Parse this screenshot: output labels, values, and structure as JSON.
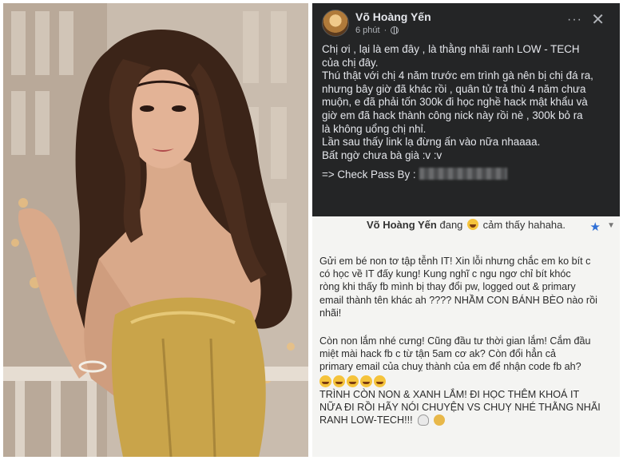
{
  "left_photo": {
    "icon": "woman-portrait-photo"
  },
  "dark_post": {
    "author": "Võ Hoàng Yến",
    "time": "6 phút",
    "privacy_icon": "globe-icon",
    "more_icon": "more-dots-icon",
    "close_icon": "close-icon",
    "lines": [
      "Chị ơi , lại là em đây , là thằng nhãi ranh LOW - TECH",
      "của chị đây.",
      "Thú thật với chị 4 năm trước em trình gà nên bị chị đá ra,",
      "nhưng bây giờ đã khác rồi , quân tử trả thù 4 năm chưa",
      "muộn, e đã phải tốn 300k đi học nghề hack mật khẩu và",
      "giờ em đã hack thành công nick này rồi nè , 300k bỏ ra",
      "là không uổng chị nhỉ.",
      "Lần sau thấy link lạ đừng ấn vào nữa nhaaaa.",
      "Bất ngờ chưa bà già :v :v"
    ],
    "check_pass_label": "=> Check Pass By :"
  },
  "light_post": {
    "author": "Võ Hoàng Yến",
    "status_before": "đang",
    "status_after": "cảm thấy hahaha.",
    "star_icon": "star-icon",
    "chevron_icon": "chevron-down-icon",
    "para1": [
      "Gửi em bé non tơ tập tễnh IT! Xin lỗi nhưng chắc em ko bít c",
      "có học về IT đấy kung! Kung nghĩ c ngu ngơ chỉ bít khóc",
      "ròng khi thấy fb mình bị thay đổi pw, logged out & primary",
      "email thành tên khác ah ???? NHẦM CON BÁNH BÈO nào rồi",
      "nhãi!"
    ],
    "para2": [
      "Còn non lắm nhé cưng! Cũng đầu tư thời gian lắm! Cắm đầu",
      "miệt mài hack fb c từ tận 5am cơ ak? Còn đổi hẳn cả",
      "primary email của chuỵ thành của em để nhận code fb ah?"
    ],
    "para3": [
      "TRÌNH CÒN NON & XANH LẮM! ĐI HỌC THÊM KHOÁ IT",
      "NỮA ĐI RỒI HÃY NÓI CHUYỆN VS CHUỴ NHÉ THẰNG NHÃI",
      "RANH LOW-TECH!!!"
    ]
  },
  "colors": {
    "dark_bg": "#242526",
    "dark_text": "#e4e6eb",
    "light_bg": "#f4f4f2",
    "dress_gold": "#c9a44a",
    "star_blue": "#2f6fd6"
  }
}
